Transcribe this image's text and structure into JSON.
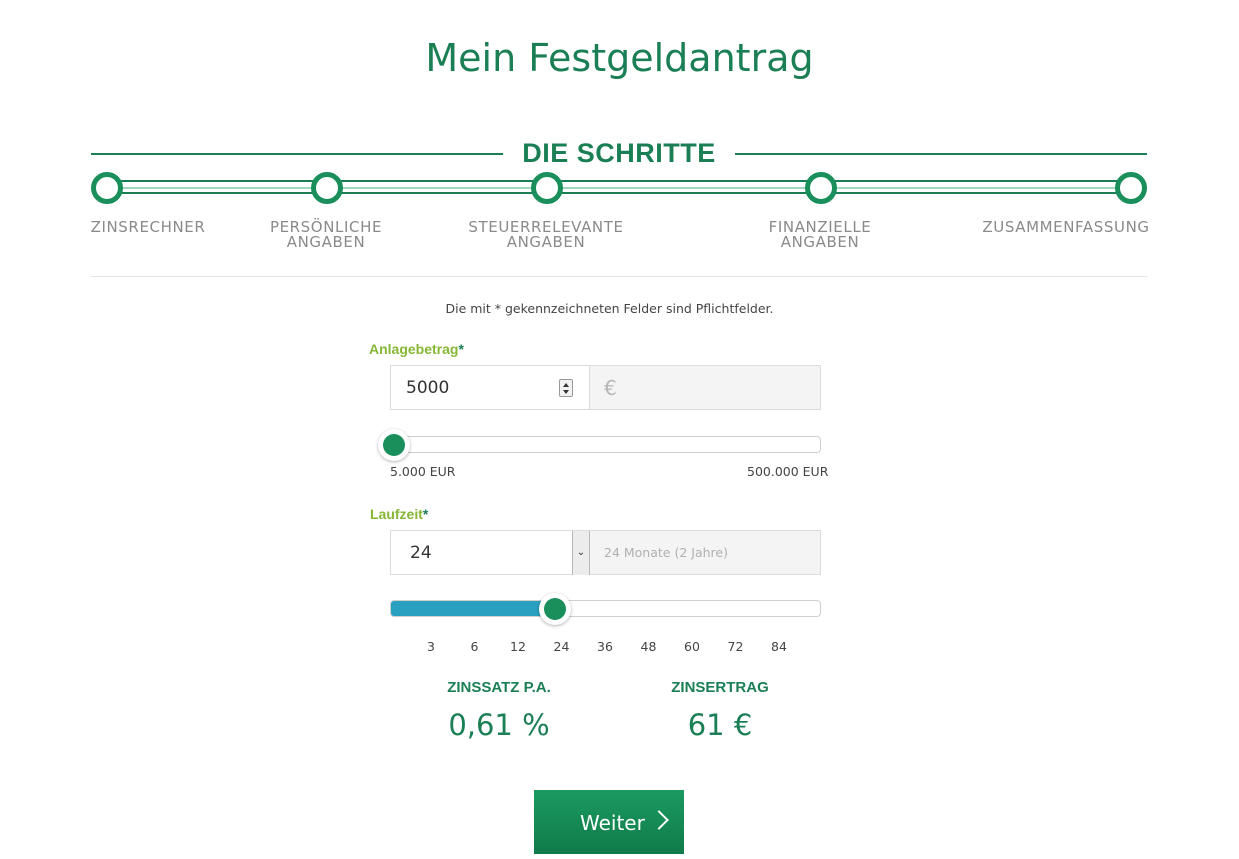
{
  "title": "Mein Festgeldantrag",
  "steps_header": "DIE SCHRITTE",
  "steps": [
    {
      "label_lines": [
        "ZINSRECHNER"
      ]
    },
    {
      "label_lines": [
        "PERSÖNLICHE",
        "ANGABEN"
      ]
    },
    {
      "label_lines": [
        "STEUERRELEVANTE",
        "ANGABEN"
      ]
    },
    {
      "label_lines": [
        "FINANZIELLE",
        "ANGABEN"
      ]
    },
    {
      "label_lines": [
        "ZUSAMMENFASSUNG"
      ]
    }
  ],
  "required_note": "Die mit * gekennzeichneten Felder sind Pflichtfelder.",
  "amount": {
    "label": "Anlagebetrag",
    "required_mark": "*",
    "value": "5000",
    "currency_addon": "€",
    "slider_min_label": "5.000 EUR",
    "slider_max_label": "500.000 EUR",
    "slider_fraction": 0.0
  },
  "term": {
    "label": "Laufzeit",
    "required_mark": "*",
    "selected": "24",
    "addon_text": "24 Monate (2 Jahre)",
    "ticks": [
      "3",
      "6",
      "12",
      "24",
      "36",
      "48",
      "60",
      "72",
      "84"
    ],
    "slider_selected_index": 3
  },
  "results": {
    "rate_label": "ZINSSATZ P.A.",
    "rate_value": "0,61 %",
    "earnings_label": "ZINSERTRAG",
    "earnings_value": "61 €"
  },
  "next_button": "Weiter",
  "colors": {
    "brand_green": "#1b7f55",
    "label_green": "#86b734",
    "slider_fill": "#2aa0c0"
  }
}
